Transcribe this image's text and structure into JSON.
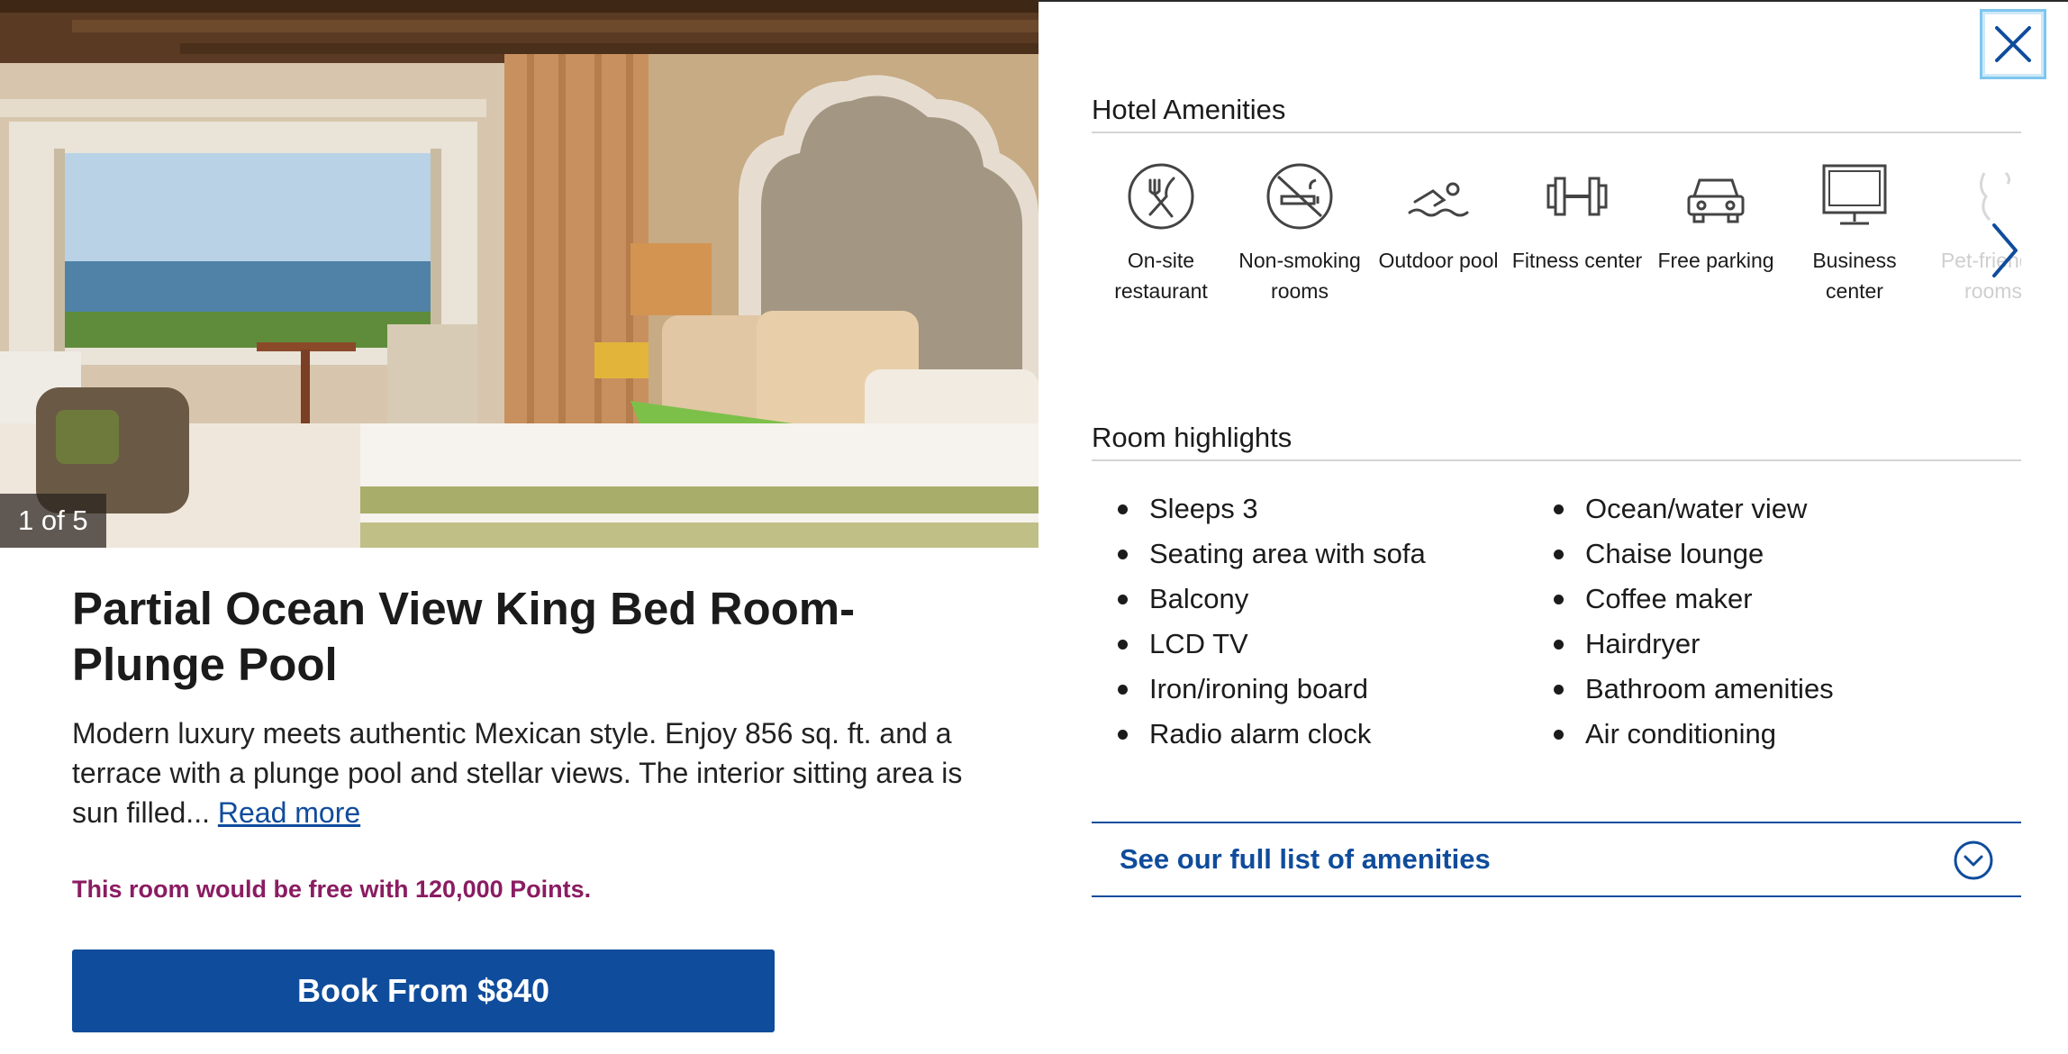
{
  "gallery": {
    "counter": "1 of 5",
    "image_description": "Hotel room photo: king bed with mosaic headboard, green pillows, curtains and ocean view window"
  },
  "room": {
    "title": "Partial Ocean View King Bed Room-Plunge Pool",
    "description": "Modern luxury meets authentic Mexican style. Enjoy 856 sq. ft. and a terrace with a plunge pool and stellar views. The interior sitting area is sun filled...",
    "read_more_label": "Read more",
    "points_note": "This room would be free with 120,000 Points.",
    "book_label": "Book From $840"
  },
  "amenities": {
    "heading": "Hotel Amenities",
    "items": [
      {
        "label": "On-site restaurant",
        "icon": "fork-knife-icon"
      },
      {
        "label": "Non-smoking rooms",
        "icon": "no-smoking-icon"
      },
      {
        "label": "Outdoor pool",
        "icon": "swimmer-icon"
      },
      {
        "label": "Fitness center",
        "icon": "dumbbell-icon"
      },
      {
        "label": "Free parking",
        "icon": "car-icon"
      },
      {
        "label": "Business center",
        "icon": "monitor-icon"
      },
      {
        "label": "Pet-friendly rooms",
        "icon": "pet-icon"
      }
    ]
  },
  "highlights": {
    "heading": "Room highlights",
    "left": [
      "Sleeps 3",
      "Seating area with sofa",
      "Balcony",
      "LCD TV",
      "Iron/ironing board",
      "Radio alarm clock"
    ],
    "right": [
      "Ocean/water view",
      "Chaise lounge",
      "Coffee maker",
      "Hairdryer",
      "Bathroom amenities",
      "Air conditioning"
    ]
  },
  "full_list_label": "See our full list of amenities",
  "colors": {
    "brand_blue": "#0f4c9c",
    "points_purple": "#8a1c62",
    "focus_ring": "#7fc6ee"
  }
}
